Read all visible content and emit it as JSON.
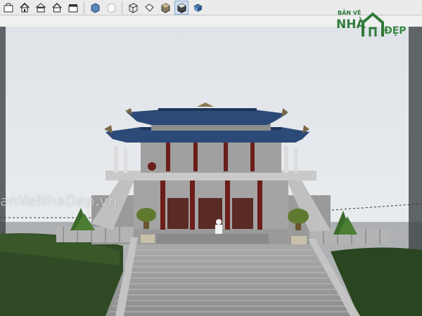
{
  "toolbar": {
    "buttons": [
      {
        "name": "camera-icon"
      },
      {
        "name": "home-icon"
      },
      {
        "name": "top-view-icon"
      },
      {
        "name": "front-view-icon"
      },
      {
        "name": "right-view-icon"
      },
      {
        "name": "xray-style-icon"
      },
      {
        "name": "wireframe-style-icon"
      },
      {
        "name": "hidden-line-style-icon"
      },
      {
        "name": "shaded-style-icon"
      },
      {
        "name": "shaded-texture-style-icon"
      },
      {
        "name": "monochrome-style-icon",
        "active": true
      },
      {
        "name": "style-extra-icon"
      }
    ]
  },
  "watermark": {
    "top_line": "BẢN VẼ",
    "logo_left": "NHÀ",
    "logo_right": "ĐẸP",
    "overlay_text": "anVeNhaDep.vn"
  },
  "colors": {
    "roof": "#2c4a78",
    "column": "#6b1e1a",
    "wall": "#a8a8a8",
    "grass": "#2f4a24",
    "sky": "#e6e9ec"
  }
}
